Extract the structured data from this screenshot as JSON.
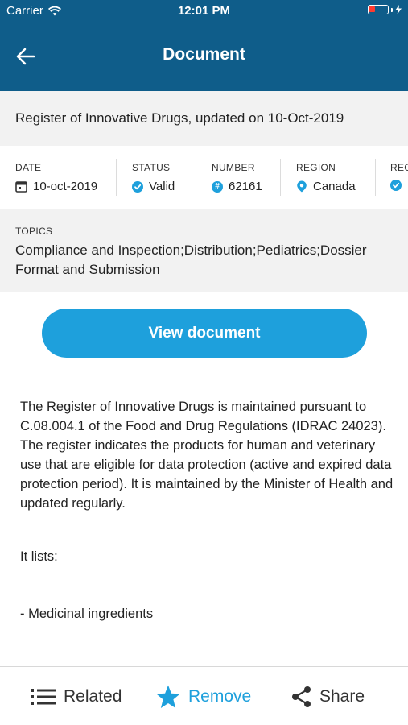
{
  "status_bar": {
    "carrier": "Carrier",
    "time": "12:01 PM",
    "battery_color": "#ff3b30"
  },
  "nav": {
    "title": "Document"
  },
  "document": {
    "title": "Register of Innovative Drugs, updated on 10-Oct-2019"
  },
  "meta": {
    "date": {
      "label": "DATE",
      "value": "10-oct-2019",
      "icon": "calendar-icon"
    },
    "status": {
      "label": "STATUS",
      "value": "Valid",
      "icon": "check-circle-icon"
    },
    "number": {
      "label": "NUMBER",
      "value": "62161",
      "icon": "hash-circle-icon"
    },
    "region": {
      "label": "REGION",
      "value": "Canada",
      "icon": "location-pin-icon"
    },
    "next": {
      "label": "REG"
    }
  },
  "topics": {
    "label": "TOPICS",
    "value": "Compliance and Inspection;Distribution;Pediatrics;Dossier Format and Submission"
  },
  "view_button": {
    "label": "View document"
  },
  "body": {
    "description": "The Register of Innovative Drugs is maintained pursuant to C.08.004.1 of the Food and Drug Regulations (IDRAC 24023). The register indicates the products for human and veterinary use that are eligible for data protection (active and expired data protection period). It is maintained by the Minister of Health and updated regularly.",
    "lists_intro": "It lists:",
    "list_item_1": "- Medicinal ingredients"
  },
  "tabbar": {
    "related": "Related",
    "remove": "Remove",
    "share": "Share"
  },
  "colors": {
    "header": "#0f5d8a",
    "accent": "#1ea0dc",
    "panel": "#f2f2f2"
  }
}
